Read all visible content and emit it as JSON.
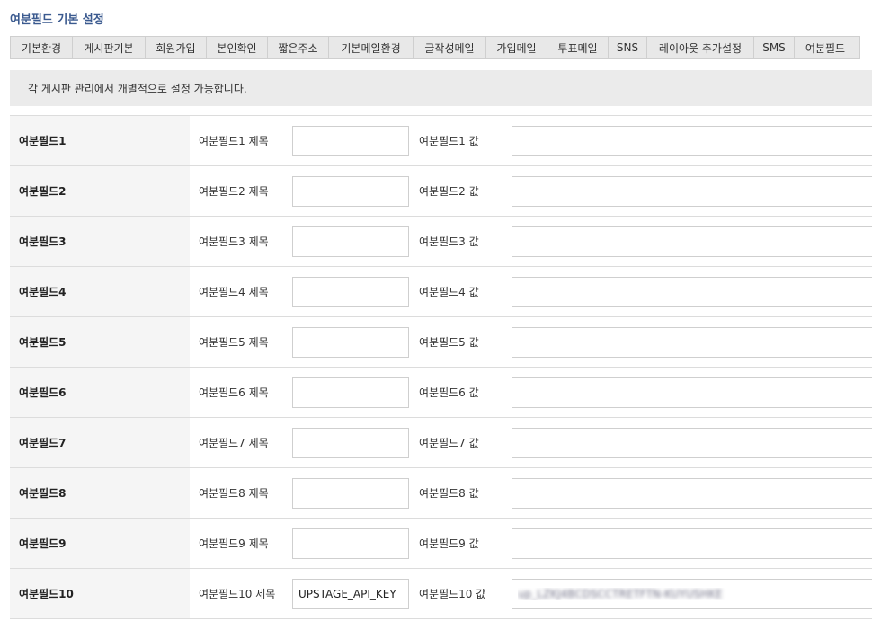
{
  "section_title": "여분필드 기본 설정",
  "tabs": [
    {
      "label": "기본환경"
    },
    {
      "label": "게시판기본"
    },
    {
      "label": "회원가입"
    },
    {
      "label": "본인확인"
    },
    {
      "label": "짧은주소"
    },
    {
      "label": "기본메일환경"
    },
    {
      "label": "글작성메일"
    },
    {
      "label": "가입메일"
    },
    {
      "label": "투표메일"
    },
    {
      "label": "SNS"
    },
    {
      "label": "레이아웃 추가설정"
    },
    {
      "label": "SMS"
    },
    {
      "label": "여분필드"
    }
  ],
  "notice": "각 게시판 관리에서 개별적으로 설정 가능합니다.",
  "rows": [
    {
      "head": "여분필드1",
      "title_label": "여분필드1 제목",
      "title_value": "",
      "value_label": "여분필드1 값",
      "value": ""
    },
    {
      "head": "여분필드2",
      "title_label": "여분필드2 제목",
      "title_value": "",
      "value_label": "여분필드2 값",
      "value": ""
    },
    {
      "head": "여분필드3",
      "title_label": "여분필드3 제목",
      "title_value": "",
      "value_label": "여분필드3 값",
      "value": ""
    },
    {
      "head": "여분필드4",
      "title_label": "여분필드4 제목",
      "title_value": "",
      "value_label": "여분필드4 값",
      "value": ""
    },
    {
      "head": "여분필드5",
      "title_label": "여분필드5 제목",
      "title_value": "",
      "value_label": "여분필드5 값",
      "value": ""
    },
    {
      "head": "여분필드6",
      "title_label": "여분필드6 제목",
      "title_value": "",
      "value_label": "여분필드6 값",
      "value": ""
    },
    {
      "head": "여분필드7",
      "title_label": "여분필드7 제목",
      "title_value": "",
      "value_label": "여분필드7 값",
      "value": ""
    },
    {
      "head": "여분필드8",
      "title_label": "여분필드8 제목",
      "title_value": "",
      "value_label": "여분필드8 값",
      "value": ""
    },
    {
      "head": "여분필드9",
      "title_label": "여분필드9 제목",
      "title_value": "",
      "value_label": "여분필드9 값",
      "value": ""
    },
    {
      "head": "여분필드10",
      "title_label": "여분필드10 제목",
      "title_value": "UPSTAGE_API_KEY",
      "value_label": "여분필드10 값",
      "value": "up_LZKJ4BCDSCCTRETFTN-KUYUSHKE"
    }
  ]
}
